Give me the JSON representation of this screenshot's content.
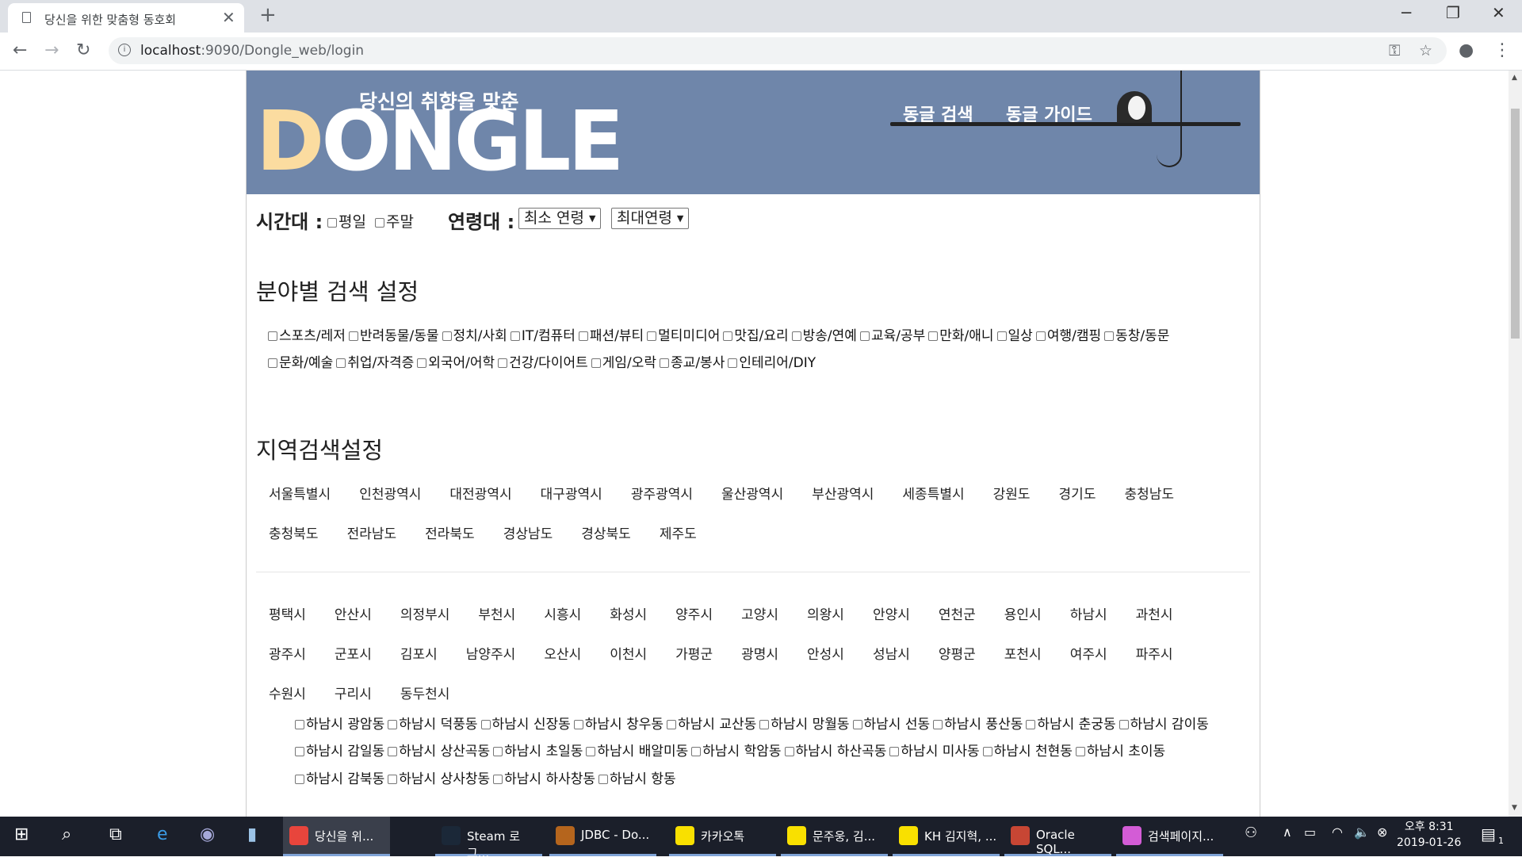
{
  "browser": {
    "tab_title": "당신을 위한 맞춤형 동호회",
    "tab_close": "✕",
    "new_tab": "+",
    "url_host": "localhost",
    "url_rest": ":9090/Dongle_web/login"
  },
  "header": {
    "tagline": "당신의 취향을 맞춘",
    "logo_first": "D",
    "logo_rest": "ONGLE",
    "nav": [
      "동글 검색",
      "동글 가이드"
    ]
  },
  "filters": {
    "time_label": "시간대 :",
    "time_options": [
      "평일",
      "주말"
    ],
    "age_label": "연령대 :",
    "age_min": "최소 연령",
    "age_max": "최대연령"
  },
  "category": {
    "title": "분야별 검색 설정",
    "row1": [
      "스포츠/레저",
      "반려동물/동물",
      "정치/사회",
      "IT/컴퓨터",
      "패션/뷰티",
      "멀티미디어",
      "맛집/요리",
      "방송/연예",
      "교육/공부",
      "만화/애니",
      "일상",
      "여행/캠핑",
      "동창/동문"
    ],
    "row2": [
      "문화/예술",
      "취업/자격증",
      "외국어/어학",
      "건강/다이어트",
      "게임/오락",
      "종교/봉사",
      "인테리어/DIY"
    ]
  },
  "region": {
    "title": "지역검색설정",
    "row1": [
      "서울특별시",
      "인천광역시",
      "대전광역시",
      "대구광역시",
      "광주광역시",
      "울산광역시",
      "부산광역시",
      "세종특별시",
      "강원도",
      "경기도",
      "충청남도"
    ],
    "row2": [
      "충청북도",
      "전라남도",
      "전라북도",
      "경상남도",
      "경상북도",
      "제주도"
    ]
  },
  "cities": {
    "row1": [
      "평택시",
      "안산시",
      "의정부시",
      "부천시",
      "시흥시",
      "화성시",
      "양주시",
      "고양시",
      "의왕시",
      "안양시",
      "연천군",
      "용인시",
      "하남시",
      "과천시"
    ],
    "row2": [
      "광주시",
      "군포시",
      "김포시",
      "남양주시",
      "오산시",
      "이천시",
      "가평군",
      "광명시",
      "안성시",
      "성남시",
      "양평군",
      "포천시",
      "여주시",
      "파주시"
    ],
    "row3": [
      "수원시",
      "구리시",
      "동두천시"
    ]
  },
  "dongs": {
    "row1": [
      "하남시 광암동",
      "하남시 덕풍동",
      "하남시 신장동",
      "하남시 창우동",
      "하남시 교산동",
      "하남시 망월동",
      "하남시 선동",
      "하남시 풍산동",
      "하남시 춘궁동",
      "하남시 감이동"
    ],
    "row2": [
      "하남시 감일동",
      "하남시 상산곡동",
      "하남시 초일동",
      "하남시 배알미동",
      "하남시 학암동",
      "하남시 하산곡동",
      "하남시 미사동",
      "하남시 천현동",
      "하남시 초이동"
    ],
    "row3": [
      "하남시 감북동",
      "하남시 상사창동",
      "하남시 하사창동",
      "하남시 항동"
    ]
  },
  "taskbar": {
    "apps": [
      "당신을 위...",
      "Steam 로그...",
      "JDBC - Do...",
      "카카오톡",
      "문주웅, 김...",
      "KH 김지혁, ...",
      "Oracle SQL...",
      "검색페이지..."
    ],
    "time": "오후 8:31",
    "date": "2019-01-26",
    "notification_count": "1"
  },
  "colors": {
    "header_bg": "#6f86aa",
    "logo_accent": "#fbdca0",
    "taskbar_bg": "#1b1f2a"
  }
}
